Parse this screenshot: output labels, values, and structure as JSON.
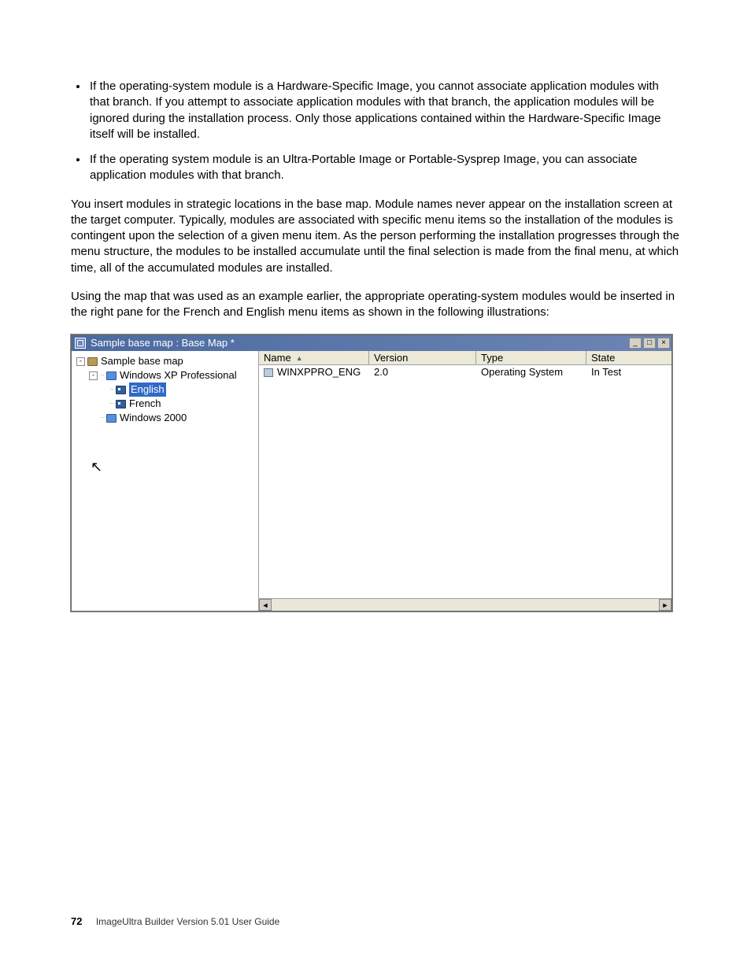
{
  "body": {
    "bullet1": "If the operating-system module is a Hardware-Specific Image, you cannot associate application modules with that branch. If you attempt to associate application modules with that branch, the application modules will be ignored during the installation process. Only those applications contained within the Hardware-Specific Image itself will be installed.",
    "bullet2": "If the operating system module is an Ultra-Portable Image or Portable-Sysprep Image, you can associate application modules with that branch.",
    "para1": "You insert modules in strategic locations in the base map. Module names never appear on the installation screen at the target computer. Typically, modules are associated with specific menu items so the installation of the modules is contingent upon the selection of a given menu item. As the person performing the installation progresses through the menu structure, the modules to be installed accumulate until the final selection is made from the final menu, at which time, all of the accumulated modules are installed.",
    "para2": "Using the map that was used as an example earlier, the appropriate operating-system modules would be inserted in the right pane for the French and English menu items as shown in the following illustrations:"
  },
  "window": {
    "title": "Sample base map : Base Map *",
    "minimize": "_",
    "maximize": "□",
    "close": "×"
  },
  "tree": {
    "root": "Sample base map",
    "winxp": "Windows XP Professional",
    "english": "English",
    "french": "French",
    "win2k": "Windows 2000"
  },
  "list": {
    "columns": {
      "name": "Name",
      "version": "Version",
      "type": "Type",
      "state": "State"
    },
    "rows": [
      {
        "name": "WINXPPRO_ENG",
        "version": "2.0",
        "type": "Operating System",
        "state": "In Test"
      }
    ],
    "scroll_left": "◄",
    "scroll_right": "►"
  },
  "footer": {
    "page_number": "72",
    "guide": "ImageUltra Builder Version 5.01 User Guide"
  }
}
